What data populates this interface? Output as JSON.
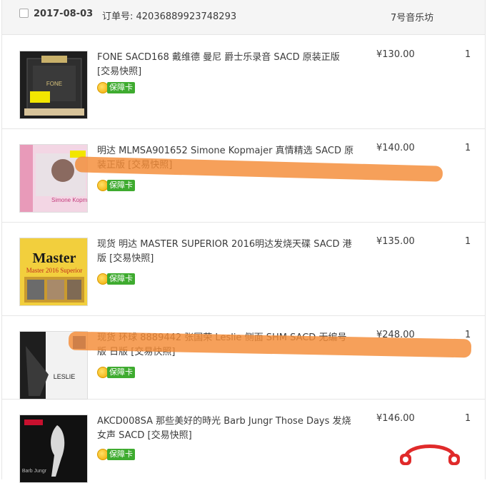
{
  "order": {
    "date": "2017-08-03",
    "order_label": "订单号: 42036889923748293",
    "shop": "7号音乐坊"
  },
  "items": [
    {
      "title": "FONE SACD168 戴维德 曼尼 爵士乐录音 SACD 原装正版 [交易快照]",
      "badge": "保障卡",
      "price": "¥130.00",
      "qty": "1"
    },
    {
      "title": "明达 MLMSA901652 Simone Kopmajer 真情精选 SACD 原装正版 [交易快照]",
      "badge": "保障卡",
      "price": "¥140.00",
      "qty": "1"
    },
    {
      "title": "现货 明达 MASTER SUPERIOR 2016明达发烧天碟 SACD 港版 [交易快照]",
      "badge": "保障卡",
      "price": "¥135.00",
      "qty": "1"
    },
    {
      "title": "现货 环球 8889442 张国荣 Leslie 侧面 SHM SACD 无编号 版 日版 [交易快照]",
      "badge": "保障卡",
      "price": "¥248.00",
      "qty": "1"
    },
    {
      "title": "AKCD008SA 那些美好的時光 Barb Jungr Those Days 发烧女声 SACD [交易快照]",
      "badge": "保障卡",
      "price": "¥146.00",
      "qty": "1"
    }
  ],
  "thumbs": {
    "cover1": "FONE",
    "cover2": "Simone Kopmajer",
    "cover3": "Master 2016 Superior",
    "cover4": "LESLIE",
    "cover5": "Barb Jungr"
  }
}
